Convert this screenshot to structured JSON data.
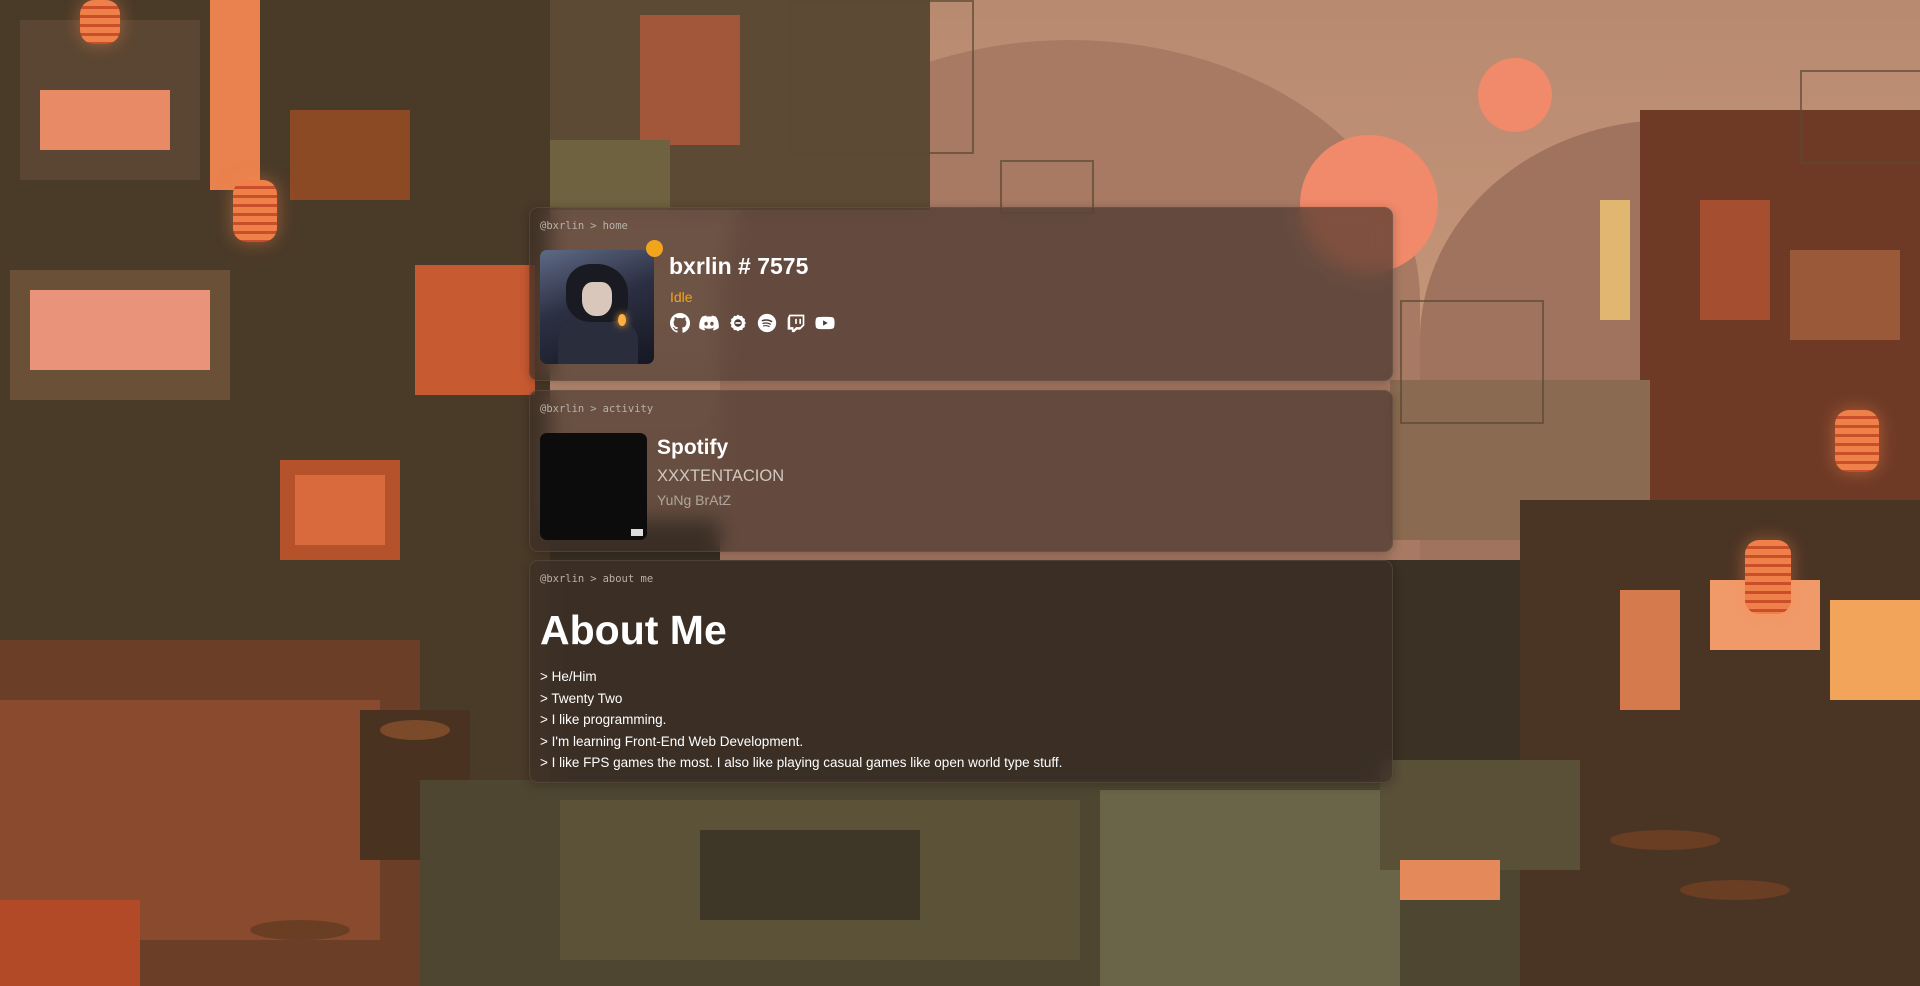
{
  "home": {
    "breadcrumb": {
      "user": "@bxrlin",
      "separator": ">",
      "page": "home"
    },
    "username": "bxrlin # 7575",
    "status": "Idle",
    "status_color": "#f2a41d",
    "social_icons": [
      "github-icon",
      "discord-icon",
      "osu-icon",
      "spotify-icon",
      "twitch-icon",
      "youtube-icon"
    ]
  },
  "activity": {
    "breadcrumb": {
      "user": "@bxrlin",
      "separator": ">",
      "page": "activity"
    },
    "app": "Spotify",
    "artist": "XXXTENTACION",
    "track": "YuNg BrAtZ"
  },
  "about": {
    "breadcrumb": {
      "user": "@bxrlin",
      "separator": ">",
      "page": "about me"
    },
    "heading": "About Me",
    "lines": [
      "> He/Him",
      "> Twenty Two",
      "> I like programming.",
      "> I'm learning Front-End Web Development.",
      "> I like FPS games the most. I also like playing casual games like open world type stuff."
    ]
  }
}
